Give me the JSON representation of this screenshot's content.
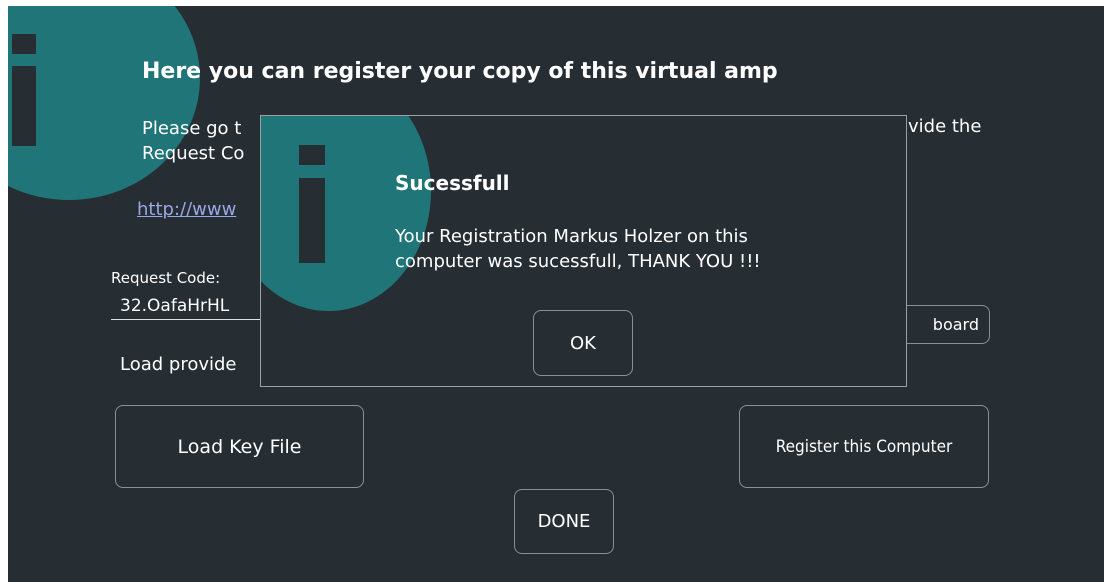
{
  "background": {
    "heading": "Here you can register your copy of this virtual amp",
    "paragraph_line1": "Please go t",
    "paragraph_line2": "Request Co",
    "paragraph_right": "vide the",
    "link_text": "http://www",
    "request_code_label": "Request Code:",
    "request_code_value": "32.OafaHrHL",
    "load_label": "Load provide",
    "clipboard_button": "board",
    "load_key_button": "Load Key File",
    "register_button": "Register this Computer",
    "done_button": "DONE"
  },
  "dialog": {
    "title": "Sucessfull",
    "message_line1": "Your Registration Markus Holzer on this",
    "message_line2": "computer was sucessfull, THANK YOU !!!",
    "ok_button": "OK"
  },
  "colors": {
    "window_bg": "#262d33",
    "info_circle": "#1f7577",
    "link": "#9aa6e6",
    "border": "#8a9096"
  },
  "icons": [
    "info-icon"
  ]
}
